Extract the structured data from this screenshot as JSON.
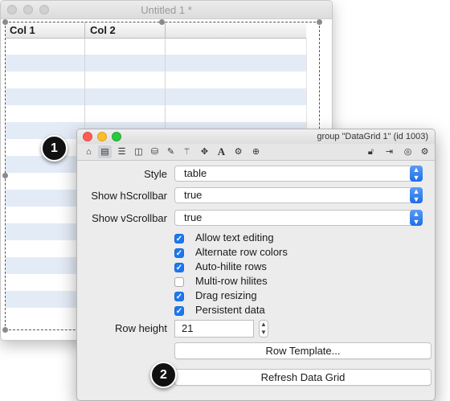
{
  "back_window": {
    "title": "Untitled 1 *",
    "columns": [
      "Col 1",
      "Col 2"
    ]
  },
  "inspector": {
    "title": "group \"DataGrid 1\" (id 1003)",
    "toolbar_left_icons": [
      "home-icon",
      "datagrid-icon",
      "list-icon",
      "columns-icon",
      "database-icon",
      "pencil-icon",
      "wand-icon",
      "move-icon",
      "text-icon",
      "gears-icon",
      "crosshair-icon"
    ],
    "toolbar_right_icons": [
      "unlock-icon",
      "import-icon",
      "target-icon",
      "gear-icon"
    ],
    "style": {
      "label": "Style",
      "value": "table"
    },
    "hscroll": {
      "label": "Show hScrollbar",
      "value": "true"
    },
    "vscroll": {
      "label": "Show vScrollbar",
      "value": "true"
    },
    "checkboxes": [
      {
        "label": "Allow text editing",
        "checked": true
      },
      {
        "label": "Alternate row colors",
        "checked": true
      },
      {
        "label": "Auto-hilite rows",
        "checked": true
      },
      {
        "label": "Multi-row hilites",
        "checked": false
      },
      {
        "label": "Drag resizing",
        "checked": true
      },
      {
        "label": "Persistent data",
        "checked": true
      }
    ],
    "row_height": {
      "label": "Row height",
      "value": "21"
    },
    "row_template_button": "Row Template...",
    "refresh_button": "Refresh Data Grid"
  },
  "annotations": [
    "1",
    "2"
  ],
  "colors": {
    "accent": "#1d77f1",
    "alt_row": "#e3ebf6",
    "close": "#fc5f57",
    "minimize": "#fdbc2e",
    "zoom": "#29c940"
  }
}
